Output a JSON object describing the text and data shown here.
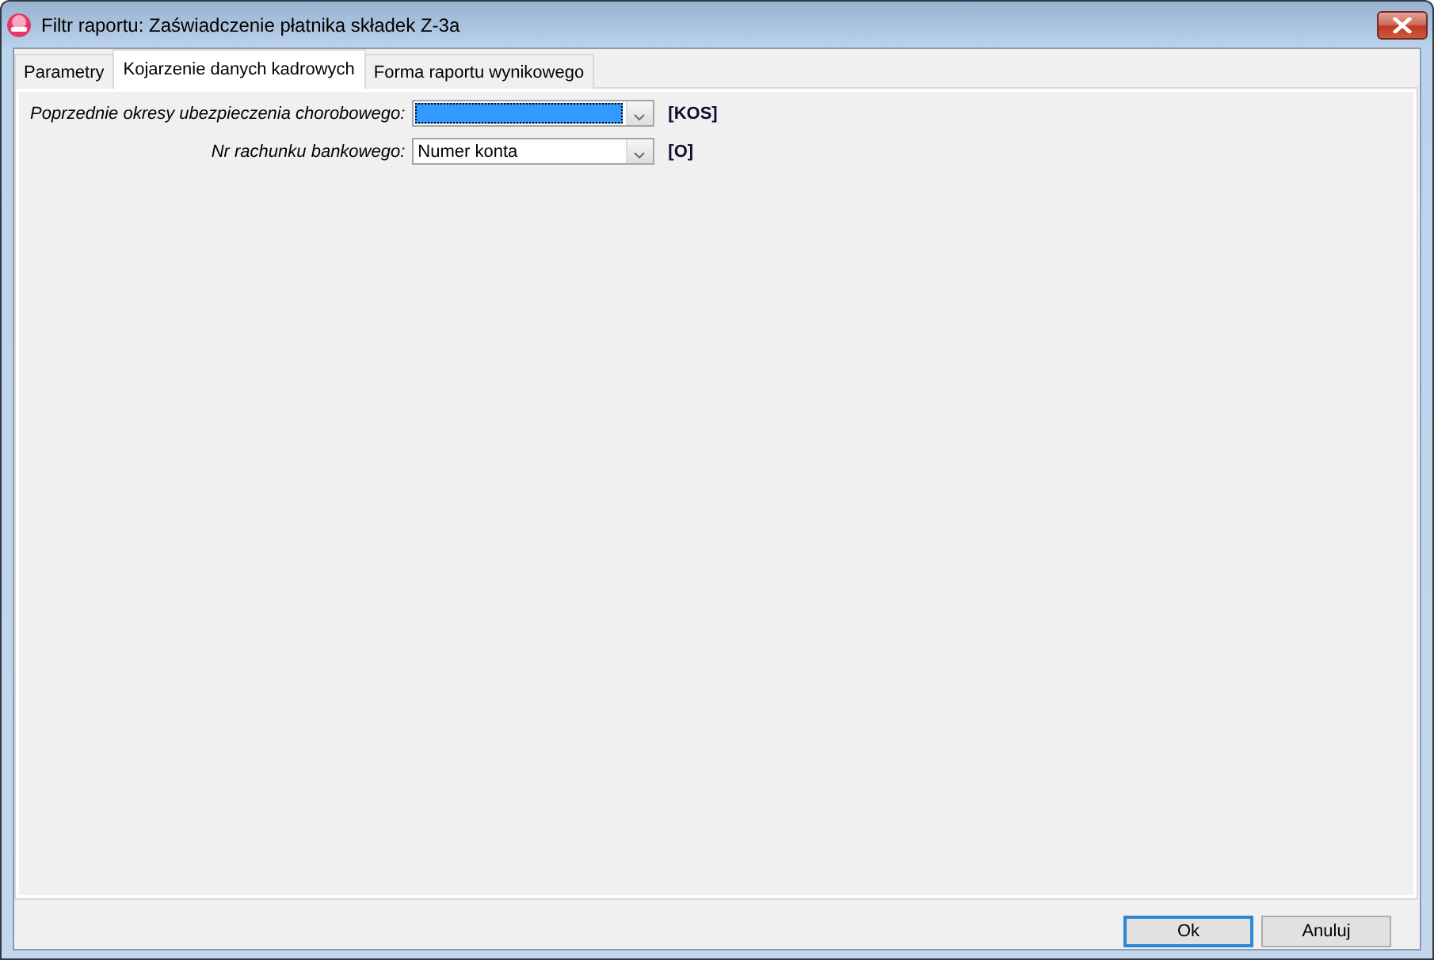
{
  "window": {
    "title": "Filtr raportu: Zaświadczenie płatnika składek Z-3a"
  },
  "tabs": [
    {
      "label": "Parametry",
      "selected": false
    },
    {
      "label": "Kojarzenie danych kadrowych",
      "selected": true
    },
    {
      "label": "Forma raportu wynikowego",
      "selected": false
    }
  ],
  "fields": [
    {
      "label": "Poprzednie okresy ubezpieczenia chorobowego:",
      "focused": true,
      "code": "[KOS]"
    },
    {
      "label": "Nr rachunku bankowego:",
      "value": "Numer konta",
      "focused": false,
      "code": "[O]"
    }
  ],
  "buttons": [
    {
      "label": "Ok",
      "default": true
    },
    {
      "label": "Anuluj",
      "default": false
    }
  ]
}
